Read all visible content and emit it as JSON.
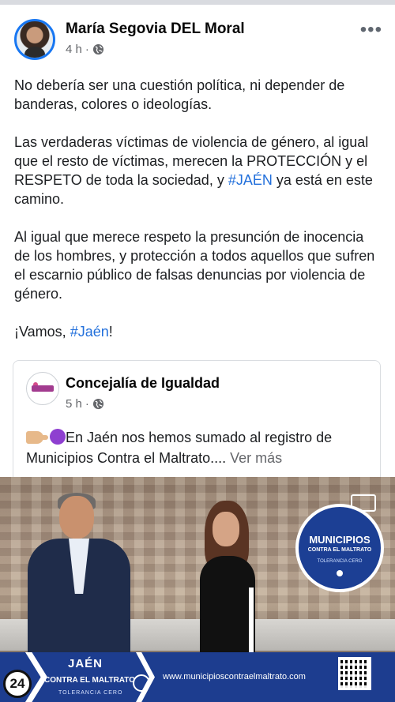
{
  "post": {
    "author": "María Segovia DEL Moral",
    "time": "4 h",
    "separator": "·",
    "more_label": "•••",
    "paragraphs": {
      "p1": "No debería ser una cuestión política, ni depender de banderas, colores o ideologías.",
      "p2a": "Las verdaderas víctimas de violencia de género, al igual que el resto de víctimas, merecen la PROTECCIÓN y el RESPETO de toda la sociedad, y ",
      "p2_hashtag": "#JAÉN",
      "p2b": " ya está en este camino.",
      "p3": "Al igual que merece respeto la presunción de inocencia de los hombres, y protección a todos aquellos que sufren el escarnio público de falsas denuncias por violencia de género.",
      "p4a": "¡Vamos, ",
      "p4_hashtag": "#Jaén",
      "p4b": "!"
    }
  },
  "shared": {
    "name": "Concejalía de Igualdad",
    "time": "5 h",
    "separator": "·",
    "text": "En Jaén nos hemos sumado al registro de Municipios  Contra el Maltrato.... ",
    "see_more": "Ver más"
  },
  "video": {
    "badge_title": "MUNICIPIOS",
    "badge_sub": "CONTRA EL MALTRATO",
    "badge_tol": "TOLERANCIA CERO",
    "banner_city": "JAÉN",
    "banner_contra": "CONTRA EL MALTRATO",
    "banner_tol": "TOLERANCIA CERO",
    "banner_url": "www.municipioscontraelmaltrato.com"
  },
  "watermark": "24",
  "icons": {
    "globe": "globe-icon",
    "more": "more-options-icon",
    "cast": "cast-icon",
    "qr": "qr-code-icon"
  },
  "colors": {
    "hashtag": "#216fdb",
    "banner": "#1d3d8f",
    "avatar_ring": "#1877f2"
  }
}
